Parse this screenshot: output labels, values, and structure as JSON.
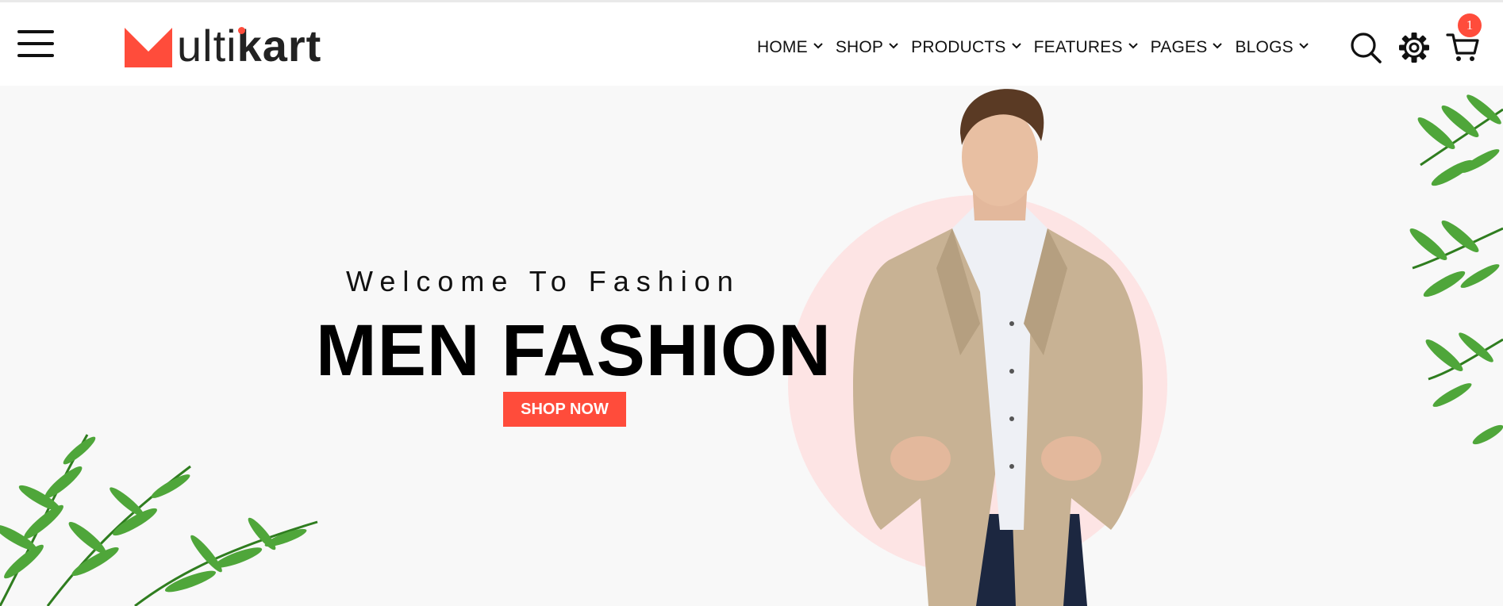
{
  "brand": {
    "logo_text_light": "ulti",
    "logo_text_bold": "kart"
  },
  "nav": {
    "items": [
      {
        "label": "HOME"
      },
      {
        "label": "SHOP"
      },
      {
        "label": "PRODUCTS"
      },
      {
        "label": "FEATURES"
      },
      {
        "label": "PAGES"
      },
      {
        "label": "BLOGS"
      }
    ]
  },
  "header_icons": {
    "search": "search-icon",
    "settings": "gear-icon",
    "cart": "cart-icon",
    "menu": "hamburger-menu-icon"
  },
  "cart": {
    "count": "1"
  },
  "hero": {
    "subtitle": "Welcome To Fashion",
    "title": "MEN FASHION",
    "cta_label": "SHOP NOW"
  },
  "colors": {
    "accent": "#ff4c3b",
    "hero_bg": "#f8f8f8",
    "circle": "#fde4e4"
  }
}
